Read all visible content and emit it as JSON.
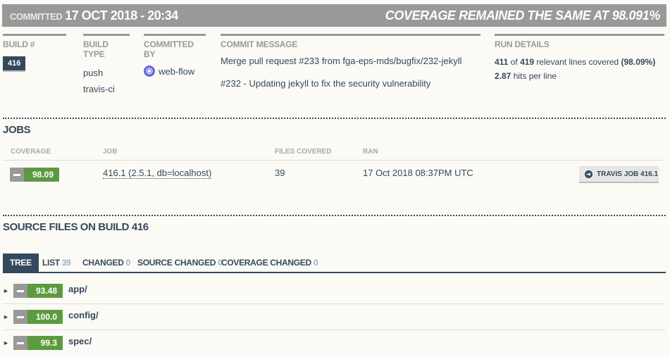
{
  "header": {
    "committed_label": "COMMITTED",
    "committed_date": "17 OCT 2018 - 20:34",
    "coverage_status": "COVERAGE REMAINED THE SAME AT 98.091%"
  },
  "summary": {
    "build": {
      "label": "BUILD #",
      "value": "416"
    },
    "build_type": {
      "label": "BUILD TYPE",
      "values": [
        "push",
        "travis-ci"
      ]
    },
    "committed_by": {
      "label": "COMMITTED BY",
      "user": "web-flow"
    },
    "commit_message": {
      "label": "COMMIT MESSAGE",
      "line1": "Merge pull request #233 from fga-eps-mds/bugfix/232-jekyll",
      "line2": "#232 - Updating jekyll to fix the security vulnerability"
    },
    "run_details": {
      "label": "RUN DETAILS",
      "covered": "411",
      "of": "of",
      "total": "419",
      "lines_text": "relevant lines covered",
      "percent": "(98.09%)",
      "hits": "2.87",
      "hits_text": "hits per line"
    }
  },
  "jobs": {
    "title": "JOBS",
    "columns": [
      "COVERAGE",
      "JOB",
      "FILES COVERED",
      "RAN"
    ],
    "rows": [
      {
        "coverage": "98.09",
        "job": "416.1 (2.5.1, db=localhost)",
        "files_covered": "39",
        "ran": "17 Oct 2018 08:37PM UTC",
        "button": "TRAVIS JOB 416.1"
      }
    ]
  },
  "source_files": {
    "title": "SOURCE FILES ON BUILD 416",
    "tabs": [
      {
        "label": "TREE",
        "count": ""
      },
      {
        "label": "LIST",
        "count": "39"
      },
      {
        "label": "CHANGED",
        "count": "0"
      },
      {
        "label": "SOURCE CHANGED",
        "count": "0"
      },
      {
        "label": "COVERAGE CHANGED",
        "count": "0"
      }
    ],
    "tree": [
      {
        "coverage": "93.48",
        "name": "app/"
      },
      {
        "coverage": "100.0",
        "name": "config/"
      },
      {
        "coverage": "99.3",
        "name": "spec/"
      }
    ]
  },
  "colors": {
    "dark": "#34495e",
    "green": "#5d9a3f",
    "grey": "#999999"
  }
}
